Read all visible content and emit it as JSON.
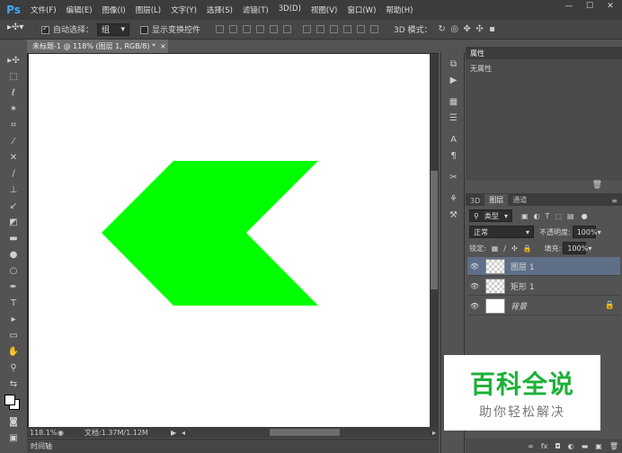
{
  "app": {
    "logo": "Ps"
  },
  "menu": [
    "文件(F)",
    "编辑(E)",
    "图像(I)",
    "图层(L)",
    "文字(Y)",
    "选择(S)",
    "滤镜(T)",
    "3D(D)",
    "视图(V)",
    "窗口(W)",
    "帮助(H)"
  ],
  "window_controls": {
    "minimize": "—",
    "restore": "☐",
    "close": "✕"
  },
  "options": {
    "auto_select_label": "自动选择：",
    "auto_select_value": "组",
    "show_transform_label": "显示变换控件",
    "mode_3d_label": "3D 模式："
  },
  "document": {
    "tab_title": "未标题-1 @ 118% (图层 1, RGB/8) *",
    "tab_close": "×",
    "shape_color": "#00ff00",
    "canvas_color": "#ffffff"
  },
  "status": {
    "zoom": "118.1%",
    "doc_info": "文档:1.37M/1.12M"
  },
  "timeline": {
    "label": "时间轴"
  },
  "properties": {
    "tab": "属性",
    "body": "无属性"
  },
  "layers": {
    "tabs": [
      "3D",
      "图层",
      "通道"
    ],
    "active_tab": "图层",
    "kind_filter": "类型",
    "blend_mode": "正常",
    "opacity_label": "不透明度:",
    "opacity_value": "100%",
    "lock_label": "锁定:",
    "fill_label": "填充:",
    "fill_value": "100%",
    "items": [
      {
        "name": "图层 1",
        "selected": true
      },
      {
        "name": "矩形 1",
        "selected": false
      },
      {
        "name": "背景",
        "selected": false
      }
    ]
  },
  "watermark": {
    "title": "百科全说",
    "subtitle": "助你轻松解决"
  }
}
